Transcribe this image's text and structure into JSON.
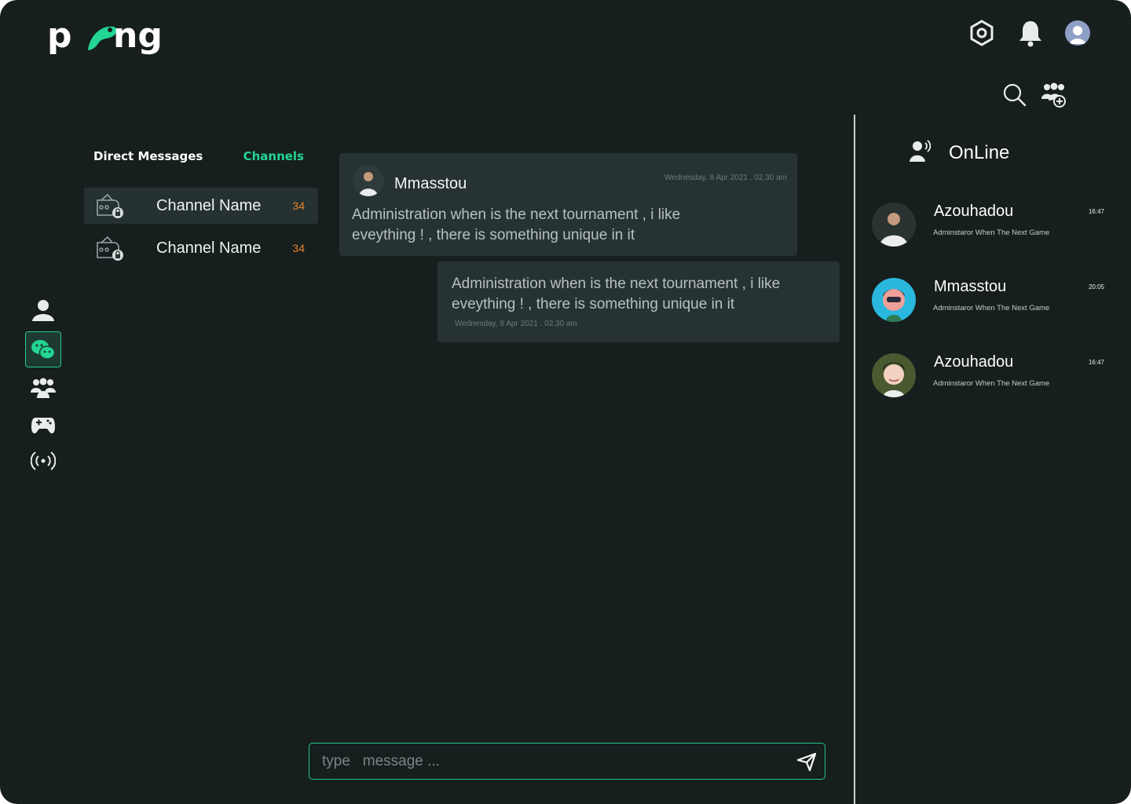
{
  "brand": {
    "name": "pong",
    "accent": "#22d592"
  },
  "header": {
    "icons": [
      "settings-icon",
      "bell-icon",
      "profile-avatar"
    ]
  },
  "toolbar": {
    "icons": [
      "search-icon",
      "add-group-icon"
    ]
  },
  "nav": {
    "items": [
      "user-icon",
      "chat-icon",
      "group-icon",
      "gamepad-icon",
      "broadcast-icon"
    ],
    "active": "chat-icon"
  },
  "tabs": {
    "direct": "Direct Messages",
    "channels": "Channels"
  },
  "channels": [
    {
      "name": "Channel Name",
      "count": "34"
    },
    {
      "name": "Channel Name",
      "count": "34"
    }
  ],
  "messages": [
    {
      "user": "Mmasstou",
      "time": "Wednesday, 8 Apr 2021 . 02.30 am",
      "text": "Administration when is the next tournament , i like eveything ! , there is something  unique in it"
    },
    {
      "time": "Wednesday, 8 Apr 2021 . 02.30 am",
      "text": "Administration when is the next tournament , i like eveything ! , there is something  unique in it"
    }
  ],
  "composer": {
    "placeholder": "type   message ..."
  },
  "online": {
    "title": "OnLine",
    "users": [
      {
        "name": "Azouhadou",
        "time": "16:47",
        "sub": "Adminstaror When The  Next Game"
      },
      {
        "name": "Mmasstou",
        "time": "20:05",
        "sub": "Adminstaror When The  Next Game"
      },
      {
        "name": "Azouhadou",
        "time": "16:47",
        "sub": "Adminstaror When The  Next Game"
      }
    ]
  }
}
